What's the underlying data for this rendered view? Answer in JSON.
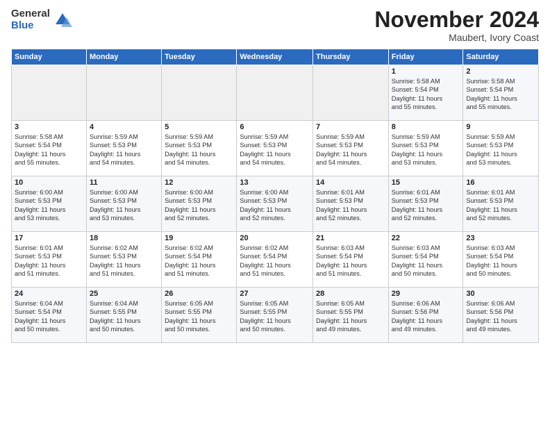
{
  "logo": {
    "general": "General",
    "blue": "Blue"
  },
  "header": {
    "month": "November 2024",
    "location": "Maubert, Ivory Coast"
  },
  "weekdays": [
    "Sunday",
    "Monday",
    "Tuesday",
    "Wednesday",
    "Thursday",
    "Friday",
    "Saturday"
  ],
  "weeks": [
    [
      {
        "day": "",
        "info": ""
      },
      {
        "day": "",
        "info": ""
      },
      {
        "day": "",
        "info": ""
      },
      {
        "day": "",
        "info": ""
      },
      {
        "day": "",
        "info": ""
      },
      {
        "day": "1",
        "info": "Sunrise: 5:58 AM\nSunset: 5:54 PM\nDaylight: 11 hours\nand 55 minutes."
      },
      {
        "day": "2",
        "info": "Sunrise: 5:58 AM\nSunset: 5:54 PM\nDaylight: 11 hours\nand 55 minutes."
      }
    ],
    [
      {
        "day": "3",
        "info": "Sunrise: 5:58 AM\nSunset: 5:54 PM\nDaylight: 11 hours\nand 55 minutes."
      },
      {
        "day": "4",
        "info": "Sunrise: 5:59 AM\nSunset: 5:53 PM\nDaylight: 11 hours\nand 54 minutes."
      },
      {
        "day": "5",
        "info": "Sunrise: 5:59 AM\nSunset: 5:53 PM\nDaylight: 11 hours\nand 54 minutes."
      },
      {
        "day": "6",
        "info": "Sunrise: 5:59 AM\nSunset: 5:53 PM\nDaylight: 11 hours\nand 54 minutes."
      },
      {
        "day": "7",
        "info": "Sunrise: 5:59 AM\nSunset: 5:53 PM\nDaylight: 11 hours\nand 54 minutes."
      },
      {
        "day": "8",
        "info": "Sunrise: 5:59 AM\nSunset: 5:53 PM\nDaylight: 11 hours\nand 53 minutes."
      },
      {
        "day": "9",
        "info": "Sunrise: 5:59 AM\nSunset: 5:53 PM\nDaylight: 11 hours\nand 53 minutes."
      }
    ],
    [
      {
        "day": "10",
        "info": "Sunrise: 6:00 AM\nSunset: 5:53 PM\nDaylight: 11 hours\nand 53 minutes."
      },
      {
        "day": "11",
        "info": "Sunrise: 6:00 AM\nSunset: 5:53 PM\nDaylight: 11 hours\nand 53 minutes."
      },
      {
        "day": "12",
        "info": "Sunrise: 6:00 AM\nSunset: 5:53 PM\nDaylight: 11 hours\nand 52 minutes."
      },
      {
        "day": "13",
        "info": "Sunrise: 6:00 AM\nSunset: 5:53 PM\nDaylight: 11 hours\nand 52 minutes."
      },
      {
        "day": "14",
        "info": "Sunrise: 6:01 AM\nSunset: 5:53 PM\nDaylight: 11 hours\nand 52 minutes."
      },
      {
        "day": "15",
        "info": "Sunrise: 6:01 AM\nSunset: 5:53 PM\nDaylight: 11 hours\nand 52 minutes."
      },
      {
        "day": "16",
        "info": "Sunrise: 6:01 AM\nSunset: 5:53 PM\nDaylight: 11 hours\nand 52 minutes."
      }
    ],
    [
      {
        "day": "17",
        "info": "Sunrise: 6:01 AM\nSunset: 5:53 PM\nDaylight: 11 hours\nand 51 minutes."
      },
      {
        "day": "18",
        "info": "Sunrise: 6:02 AM\nSunset: 5:53 PM\nDaylight: 11 hours\nand 51 minutes."
      },
      {
        "day": "19",
        "info": "Sunrise: 6:02 AM\nSunset: 5:54 PM\nDaylight: 11 hours\nand 51 minutes."
      },
      {
        "day": "20",
        "info": "Sunrise: 6:02 AM\nSunset: 5:54 PM\nDaylight: 11 hours\nand 51 minutes."
      },
      {
        "day": "21",
        "info": "Sunrise: 6:03 AM\nSunset: 5:54 PM\nDaylight: 11 hours\nand 51 minutes."
      },
      {
        "day": "22",
        "info": "Sunrise: 6:03 AM\nSunset: 5:54 PM\nDaylight: 11 hours\nand 50 minutes."
      },
      {
        "day": "23",
        "info": "Sunrise: 6:03 AM\nSunset: 5:54 PM\nDaylight: 11 hours\nand 50 minutes."
      }
    ],
    [
      {
        "day": "24",
        "info": "Sunrise: 6:04 AM\nSunset: 5:54 PM\nDaylight: 11 hours\nand 50 minutes."
      },
      {
        "day": "25",
        "info": "Sunrise: 6:04 AM\nSunset: 5:55 PM\nDaylight: 11 hours\nand 50 minutes."
      },
      {
        "day": "26",
        "info": "Sunrise: 6:05 AM\nSunset: 5:55 PM\nDaylight: 11 hours\nand 50 minutes."
      },
      {
        "day": "27",
        "info": "Sunrise: 6:05 AM\nSunset: 5:55 PM\nDaylight: 11 hours\nand 50 minutes."
      },
      {
        "day": "28",
        "info": "Sunrise: 6:05 AM\nSunset: 5:55 PM\nDaylight: 11 hours\nand 49 minutes."
      },
      {
        "day": "29",
        "info": "Sunrise: 6:06 AM\nSunset: 5:56 PM\nDaylight: 11 hours\nand 49 minutes."
      },
      {
        "day": "30",
        "info": "Sunrise: 6:06 AM\nSunset: 5:56 PM\nDaylight: 11 hours\nand 49 minutes."
      }
    ]
  ]
}
